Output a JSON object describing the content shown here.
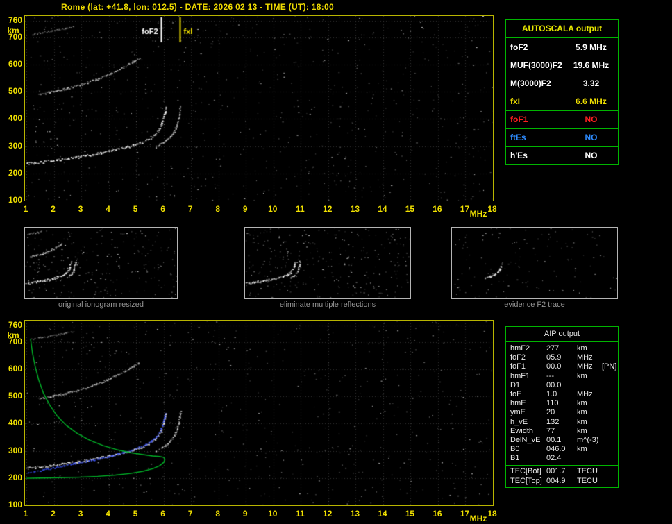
{
  "title": "Rome (lat: +41.8, lon: 012.5) - DATE: 2026 02 13 - TIME (UT): 18:00",
  "colors": {
    "axis_yellow": "#f0e000",
    "plot_border": "#b8b400",
    "table_green": "#00b400",
    "grid_gray": "#343434",
    "profile_green": "#00b428",
    "restored_blue": "#3c55ff",
    "caption_gray": "#949494",
    "status_red": "#ff2020",
    "status_blue": "#2e8cff",
    "white": "#ffffff"
  },
  "autoscala": {
    "title": "AUTOSCALA output",
    "rows": [
      {
        "label": "foF2",
        "value": "5.9 MHz",
        "color": "#ffffff"
      },
      {
        "label": "MUF(3000)F2",
        "value": "19.6 MHz",
        "color": "#ffffff"
      },
      {
        "label": "M(3000)F2",
        "value": "3.32",
        "color": "#ffffff"
      },
      {
        "label": "fxI",
        "value": "6.6 MHz",
        "color": "#f0e000"
      },
      {
        "label": "foF1",
        "value": "NO",
        "color": "#ff2020"
      },
      {
        "label": "ftEs",
        "value": "NO",
        "color": "#2e8cff"
      },
      {
        "label": "h'Es",
        "value": "NO",
        "color": "#ffffff"
      }
    ]
  },
  "aip": {
    "title": "AIP output",
    "rows": [
      {
        "label": "hmF2",
        "value": "277",
        "unit": "km",
        "extra": ""
      },
      {
        "label": "foF2",
        "value": "05.9",
        "unit": "MHz",
        "extra": ""
      },
      {
        "label": "foF1",
        "value": "00.0",
        "unit": "MHz",
        "extra": "[PN]"
      },
      {
        "label": "hmF1",
        "value": "---",
        "unit": "km",
        "extra": ""
      },
      {
        "label": "D1",
        "value": "00.0",
        "unit": "",
        "extra": ""
      },
      {
        "label": "foE",
        "value": "1.0",
        "unit": "MHz",
        "extra": ""
      },
      {
        "label": "hmE",
        "value": "110",
        "unit": "km",
        "extra": ""
      },
      {
        "label": "ymE",
        "value": "20",
        "unit": "km",
        "extra": ""
      },
      {
        "label": "h_vE",
        "value": "132",
        "unit": "km",
        "extra": ""
      },
      {
        "label": "Ewidth",
        "value": "77",
        "unit": "km",
        "extra": ""
      },
      {
        "label": "DelN_vE",
        "value": "00.1",
        "unit": "m^(-3)",
        "extra": ""
      },
      {
        "label": "B0",
        "value": "046.0",
        "unit": "km",
        "extra": ""
      },
      {
        "label": "B1",
        "value": "02.4",
        "unit": "",
        "extra": ""
      }
    ],
    "tec_rows": [
      {
        "label": "TEC[Bot]",
        "value": "001.7",
        "unit": "TECU",
        "extra": ""
      },
      {
        "label": "TEC[Top]",
        "value": "004.9",
        "unit": "TECU",
        "extra": ""
      }
    ]
  },
  "thumbnails": [
    {
      "caption": "original ionogram resized",
      "traces": [
        "f2_o",
        "f2_x",
        "hop2",
        "hop3"
      ],
      "noise_dots": 260,
      "seed": 5
    },
    {
      "caption": "eliminate multiple reflections",
      "traces": [
        "f2_o",
        "f2_x"
      ],
      "noise_dots": 300,
      "seed": 6
    },
    {
      "caption": "evidence F2 trace",
      "traces": [
        "f2_evidence"
      ],
      "noise_dots": 130,
      "seed": 9
    }
  ],
  "chart_data": {
    "type": "scatter",
    "title": "Ionogram with AUTOSCALA interpretation",
    "xlabel": "MHz",
    "ylabel": "km",
    "axes": {
      "x_unit": "MHz",
      "y_unit": "km",
      "xlim": [
        1,
        18
      ],
      "ylim": [
        100,
        760
      ],
      "xticks": [
        1,
        2,
        3,
        4,
        5,
        6,
        7,
        8,
        9,
        10,
        11,
        12,
        13,
        14,
        15,
        16,
        17,
        18
      ],
      "yticks": [
        760,
        700,
        600,
        500,
        400,
        300,
        200,
        100
      ],
      "grid": true
    },
    "top_panel": {
      "traces": [
        "f2_o",
        "f2_x",
        "hop2",
        "hop3"
      ],
      "noise_dots": 650,
      "seed": 11,
      "markers": [
        {
          "label": "foF2",
          "freq_mhz": 5.9,
          "color": "#ffffff",
          "side": "left"
        },
        {
          "label": "fxI",
          "freq_mhz": 6.6,
          "color": "#f0e000",
          "side": "right"
        }
      ]
    },
    "bottom_panel": {
      "traces": [
        "hop2",
        "hop3",
        "f2_o",
        "f2_x",
        "restored",
        "profile"
      ],
      "noise_dots": 520,
      "seed": 23,
      "markers": []
    },
    "trace_defs": {
      "f2_o": {
        "name": "F2-ordinary-trace",
        "color": "#ffffff",
        "style": "speckle",
        "size": 2,
        "spread": 3,
        "alpha": 0.95,
        "points": [
          [
            1.0,
            237
          ],
          [
            1.3,
            240
          ],
          [
            1.6,
            243
          ],
          [
            1.9,
            247
          ],
          [
            2.2,
            251
          ],
          [
            2.5,
            256
          ],
          [
            2.8,
            260
          ],
          [
            3.1,
            265
          ],
          [
            3.4,
            270
          ],
          [
            3.7,
            276
          ],
          [
            4.0,
            282
          ],
          [
            4.3,
            289
          ],
          [
            4.6,
            296
          ],
          [
            4.9,
            305
          ],
          [
            5.2,
            315
          ],
          [
            5.45,
            327
          ],
          [
            5.65,
            341
          ],
          [
            5.8,
            358
          ],
          [
            5.9,
            378
          ],
          [
            5.98,
            400
          ],
          [
            6.04,
            422
          ],
          [
            6.08,
            442
          ]
        ]
      },
      "f2_x": {
        "name": "F2-extraordinary-trace",
        "color": "#e8e8e8",
        "style": "speckle",
        "size": 2,
        "spread": 2.5,
        "alpha": 0.85,
        "points": [
          [
            5.7,
            298
          ],
          [
            5.9,
            310
          ],
          [
            6.1,
            323
          ],
          [
            6.25,
            338
          ],
          [
            6.38,
            356
          ],
          [
            6.47,
            378
          ],
          [
            6.53,
            402
          ],
          [
            6.57,
            425
          ],
          [
            6.6,
            445
          ]
        ]
      },
      "hop2": {
        "name": "second-hop-multiple",
        "color": "#dcdcdc",
        "style": "speckle",
        "size": 2,
        "spread": 2.5,
        "alpha": 0.8,
        "points": [
          [
            1.45,
            492
          ],
          [
            1.8,
            499
          ],
          [
            2.15,
            506
          ],
          [
            2.5,
            514
          ],
          [
            2.85,
            523
          ],
          [
            3.2,
            534
          ],
          [
            3.55,
            546
          ],
          [
            3.9,
            560
          ],
          [
            4.25,
            576
          ],
          [
            4.6,
            594
          ],
          [
            4.9,
            612
          ],
          [
            5.1,
            624
          ]
        ]
      },
      "hop3": {
        "name": "third-hop-multiple",
        "color": "#c8c8c8",
        "style": "speckle",
        "size": 1.6,
        "spread": 2,
        "alpha": 0.6,
        "points": [
          [
            1.2,
            712
          ],
          [
            1.5,
            717
          ],
          [
            1.8,
            722
          ],
          [
            2.1,
            727
          ],
          [
            2.4,
            733
          ],
          [
            2.7,
            739
          ]
        ]
      },
      "profile": {
        "name": "electron-density-profile",
        "color": "#00b428",
        "style": "line",
        "size": 1.4,
        "points": [
          [
            1.15,
            712
          ],
          [
            1.22,
            660
          ],
          [
            1.32,
            610
          ],
          [
            1.45,
            560
          ],
          [
            1.62,
            512
          ],
          [
            1.85,
            468
          ],
          [
            2.12,
            428
          ],
          [
            2.45,
            394
          ],
          [
            2.85,
            364
          ],
          [
            3.3,
            339
          ],
          [
            3.8,
            319
          ],
          [
            4.3,
            304
          ],
          [
            4.8,
            293
          ],
          [
            5.25,
            286
          ],
          [
            5.6,
            281
          ],
          [
            5.85,
            279
          ],
          [
            6.0,
            276
          ],
          [
            6.05,
            268
          ],
          [
            6.0,
            257
          ],
          [
            5.85,
            245
          ],
          [
            5.6,
            234
          ],
          [
            5.25,
            225
          ],
          [
            4.8,
            217
          ],
          [
            4.25,
            211
          ],
          [
            3.6,
            206
          ],
          [
            2.9,
            203
          ],
          [
            2.2,
            201
          ],
          [
            1.5,
            200
          ],
          [
            1.0,
            199
          ]
        ]
      },
      "restored": {
        "name": "restored-trace",
        "color": "#3c55ff",
        "style": "speckle",
        "size": 2,
        "spread": 2.4,
        "alpha": 0.9,
        "points": [
          [
            1.05,
            222
          ],
          [
            1.25,
            224
          ],
          [
            1.5,
            228
          ],
          [
            1.8,
            234
          ],
          [
            2.1,
            241
          ],
          [
            2.4,
            248
          ],
          [
            2.7,
            254
          ],
          [
            3.0,
            260
          ],
          [
            3.3,
            266
          ],
          [
            3.6,
            272
          ],
          [
            3.9,
            279
          ],
          [
            4.2,
            286
          ],
          [
            4.5,
            294
          ],
          [
            4.8,
            303
          ],
          [
            5.1,
            313
          ],
          [
            5.35,
            324
          ],
          [
            5.55,
            337
          ],
          [
            5.72,
            352
          ],
          [
            5.85,
            370
          ],
          [
            5.94,
            392
          ],
          [
            6.0,
            415
          ],
          [
            6.05,
            438
          ]
        ]
      },
      "f2_evidence": {
        "name": "evidence-F2-trace",
        "color": "#ffffff",
        "style": "speckle",
        "size": 2,
        "spread": 2.5,
        "alpha": 0.9,
        "points": [
          [
            4.3,
            289
          ],
          [
            4.6,
            296
          ],
          [
            4.9,
            305
          ],
          [
            5.2,
            315
          ],
          [
            5.45,
            327
          ],
          [
            5.65,
            341
          ],
          [
            5.8,
            358
          ],
          [
            5.9,
            378
          ],
          [
            5.98,
            400
          ],
          [
            6.04,
            420
          ]
        ]
      }
    }
  }
}
